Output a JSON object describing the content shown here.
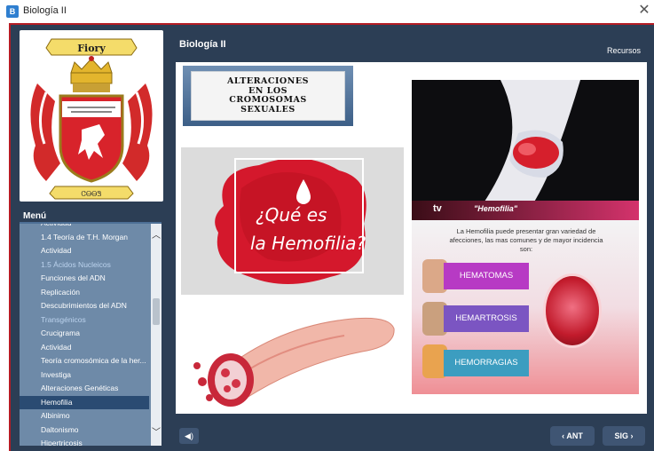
{
  "window": {
    "title": "Biología II",
    "close_glyph": "✕",
    "app_icon": "B"
  },
  "header": {
    "course_title": "Biología II",
    "resources_label": "Recursos"
  },
  "logo": {
    "banner_text": "Fiory",
    "ribbon_text": "ᏣᎾᎾᏕ"
  },
  "menu": {
    "label": "Menú",
    "items": [
      {
        "label": "Actividad",
        "state": "normal"
      },
      {
        "label": "1.4 Teoría de T.H. Morgan",
        "state": "normal"
      },
      {
        "label": "Actividad",
        "state": "normal"
      },
      {
        "label": "1.5 Ácidos Nucleicos",
        "state": "done"
      },
      {
        "label": "Funciones del ADN",
        "state": "normal"
      },
      {
        "label": "Replicación",
        "state": "normal"
      },
      {
        "label": "Descubrimientos del ADN",
        "state": "normal"
      },
      {
        "label": "Transgénicos",
        "state": "done"
      },
      {
        "label": "Crucigrama",
        "state": "normal"
      },
      {
        "label": "Actividad",
        "state": "normal"
      },
      {
        "label": "Teoría cromosómica de la her...",
        "state": "normal"
      },
      {
        "label": "Investiga",
        "state": "normal"
      },
      {
        "label": "Alteraciones Genéticas",
        "state": "normal"
      },
      {
        "label": "Hemofilia",
        "state": "active"
      },
      {
        "label": "Albinimo",
        "state": "normal"
      },
      {
        "label": "Daltonismo",
        "state": "normal"
      },
      {
        "label": "Hipertricosis",
        "state": "normal"
      }
    ]
  },
  "content": {
    "title_card": [
      "ALTERACIONES",
      "EN LOS",
      "CROMOSOMAS",
      "SEXUALES"
    ],
    "hemo_question": {
      "line1": "¿Qué es",
      "line2": "la Hemofilia?"
    },
    "tv": {
      "logo": "tv",
      "caption": "\"Hemofilia\""
    },
    "info_text": "La Hemofilia puede presentar gran variedad de afecciones, las mas comunes y de mayor incidencia son:",
    "conditions": [
      "HEMATOMAS",
      "HEMARTROSIS",
      "HEMORRAGIAS"
    ]
  },
  "footer": {
    "prev_label": "‹ ANT",
    "next_label": "SIG ›",
    "audio_icon": "speaker-icon"
  },
  "colors": {
    "frame_bg": "#2c3e55",
    "frame_border": "#b51c24",
    "menu_bg": "#6e8aa8",
    "menu_active": "#2a4b72",
    "nav_button": "#3f5573"
  }
}
